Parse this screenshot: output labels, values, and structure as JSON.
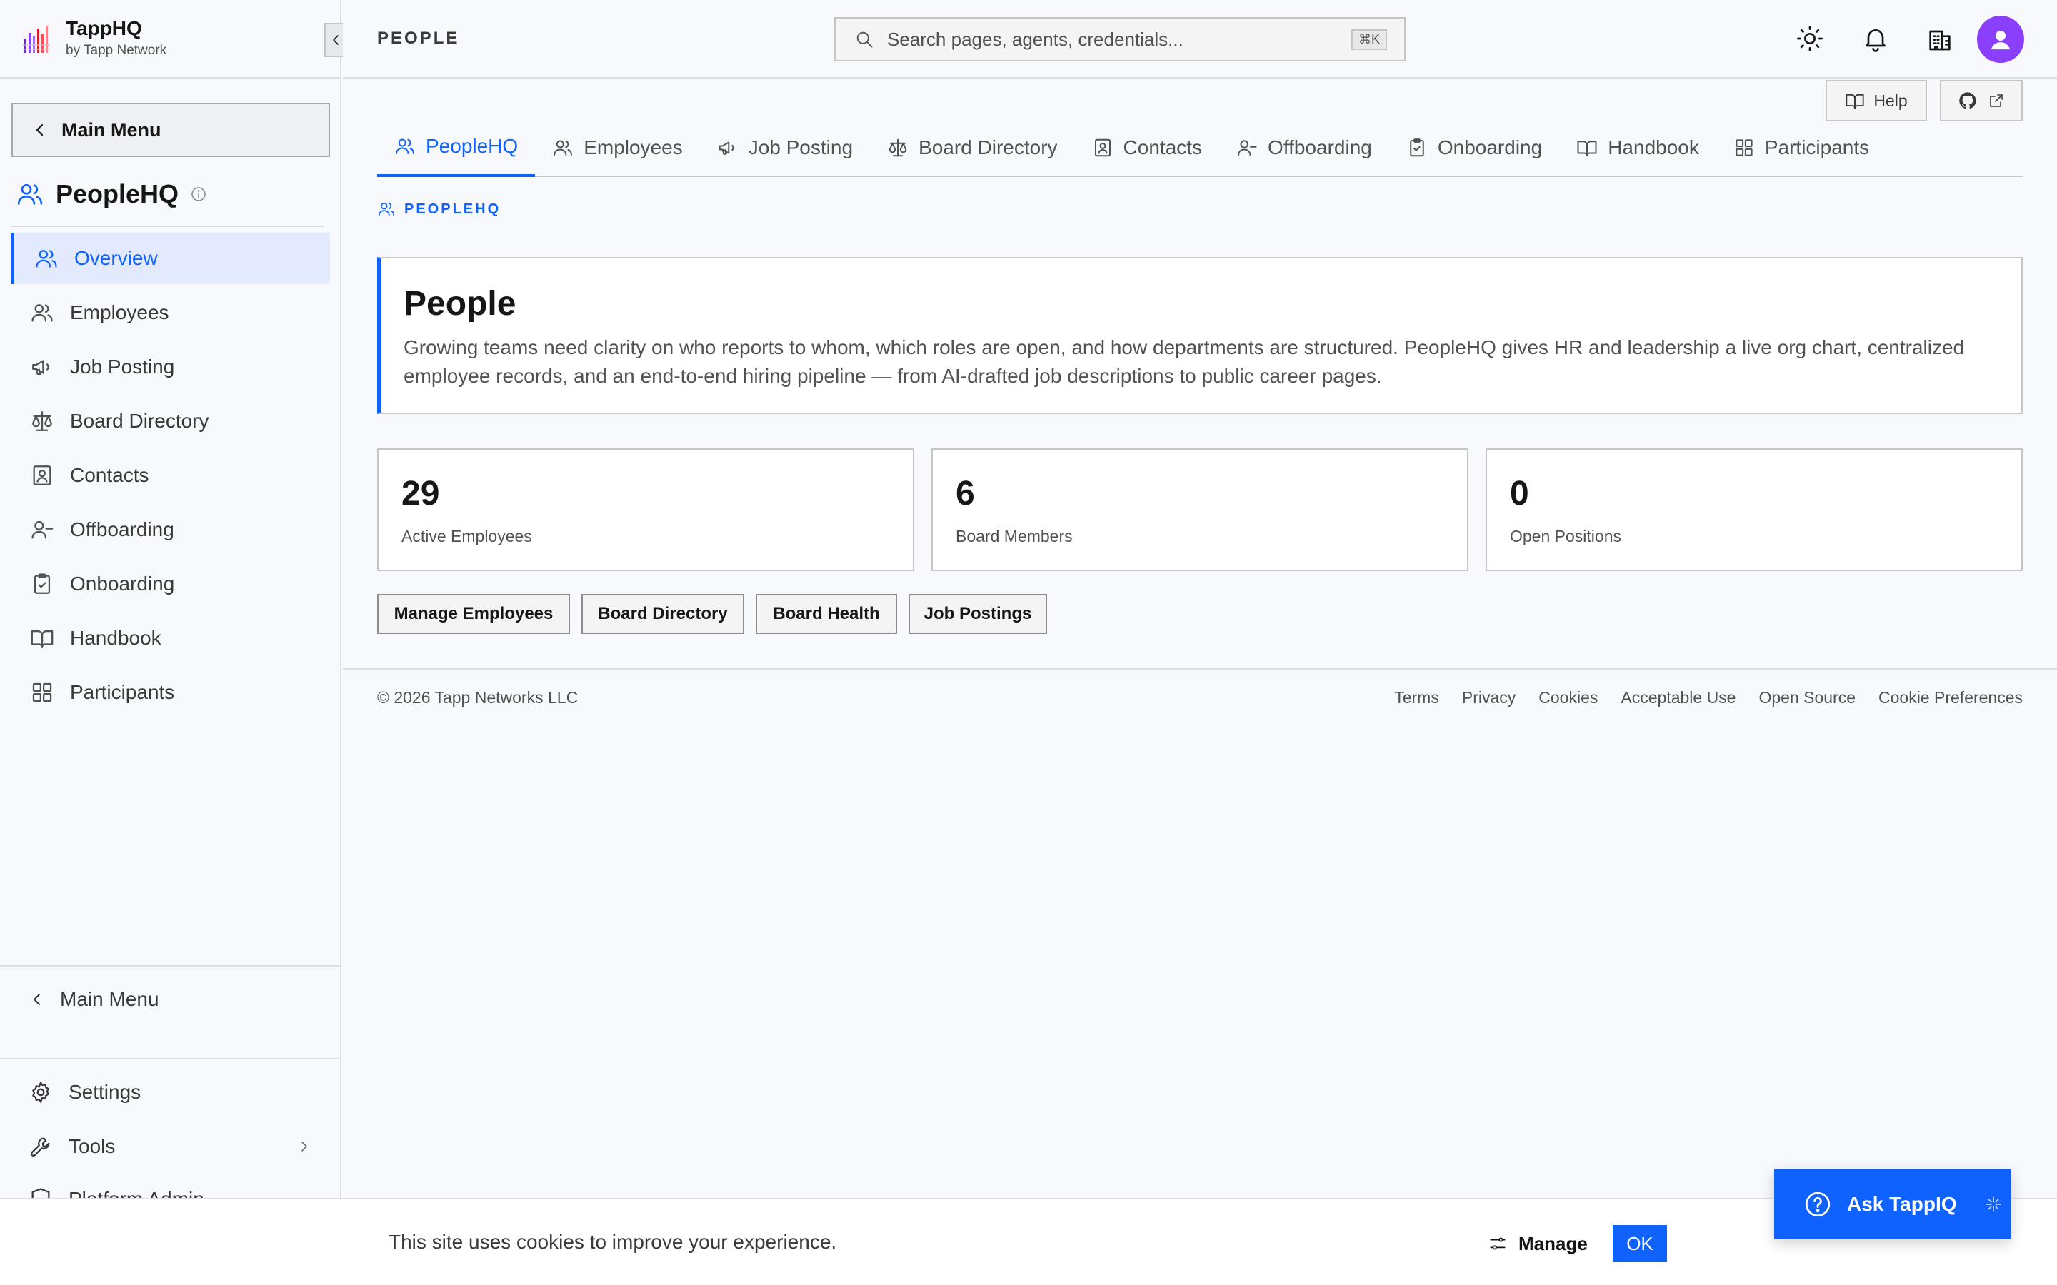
{
  "brand": {
    "name": "TappHQ",
    "subtitle": "by Tapp Network"
  },
  "sidebar": {
    "main_menu_label": "Main Menu",
    "section_title": "PeopleHQ",
    "items": [
      {
        "label": "Overview",
        "icon": "users-icon",
        "active": true
      },
      {
        "label": "Employees",
        "icon": "users-icon"
      },
      {
        "label": "Job Posting",
        "icon": "megaphone-icon"
      },
      {
        "label": "Board Directory",
        "icon": "scale-icon"
      },
      {
        "label": "Contacts",
        "icon": "contact-card-icon"
      },
      {
        "label": "Offboarding",
        "icon": "user-minus-icon"
      },
      {
        "label": "Onboarding",
        "icon": "clipboard-check-icon"
      },
      {
        "label": "Handbook",
        "icon": "book-open-icon"
      },
      {
        "label": "Participants",
        "icon": "grid-icon"
      }
    ],
    "back_label": "Main Menu",
    "settings_label": "Settings",
    "tools_label": "Tools",
    "platform_label": "Platform Admin"
  },
  "header": {
    "page_label": "PEOPLE",
    "search_placeholder": "Search pages, agents, credentials...",
    "search_shortcut": "⌘K"
  },
  "help": {
    "label": "Help"
  },
  "tabs": [
    {
      "label": "PeopleHQ",
      "icon": "users-icon",
      "active": true
    },
    {
      "label": "Employees",
      "icon": "users-icon"
    },
    {
      "label": "Job Posting",
      "icon": "megaphone-icon"
    },
    {
      "label": "Board Directory",
      "icon": "scale-icon"
    },
    {
      "label": "Contacts",
      "icon": "contact-card-icon"
    },
    {
      "label": "Offboarding",
      "icon": "user-minus-icon"
    },
    {
      "label": "Onboarding",
      "icon": "clipboard-check-icon"
    },
    {
      "label": "Handbook",
      "icon": "book-open-icon"
    },
    {
      "label": "Participants",
      "icon": "grid-icon"
    }
  ],
  "content": {
    "crumb": "PEOPLEHQ",
    "hero_title": "People",
    "hero_description": "Growing teams need clarity on who reports to whom, which roles are open, and how departments are structured. PeopleHQ gives HR and leadership a live org chart, centralized employee records, and an end-to-end hiring pipeline — from AI-drafted job descriptions to public career pages.",
    "stats": [
      {
        "value": "29",
        "label": "Active Employees"
      },
      {
        "value": "6",
        "label": "Board Members"
      },
      {
        "value": "0",
        "label": "Open Positions"
      }
    ],
    "actions": [
      "Manage Employees",
      "Board Directory",
      "Board Health",
      "Job Postings"
    ]
  },
  "footer": {
    "copyright": "© 2026 Tapp Networks LLC",
    "links": [
      "Terms",
      "Privacy",
      "Cookies",
      "Acceptable Use",
      "Open Source",
      "Cookie Preferences"
    ]
  },
  "cookie_banner": {
    "text": "This site uses cookies to improve your experience.",
    "manage_label": "Manage",
    "ok_label": "OK"
  },
  "assistant": {
    "label": "Ask TappIQ"
  },
  "colors": {
    "accent": "#0f62fe",
    "avatar": "#8a3ffc",
    "background": "#f8f9fd"
  }
}
